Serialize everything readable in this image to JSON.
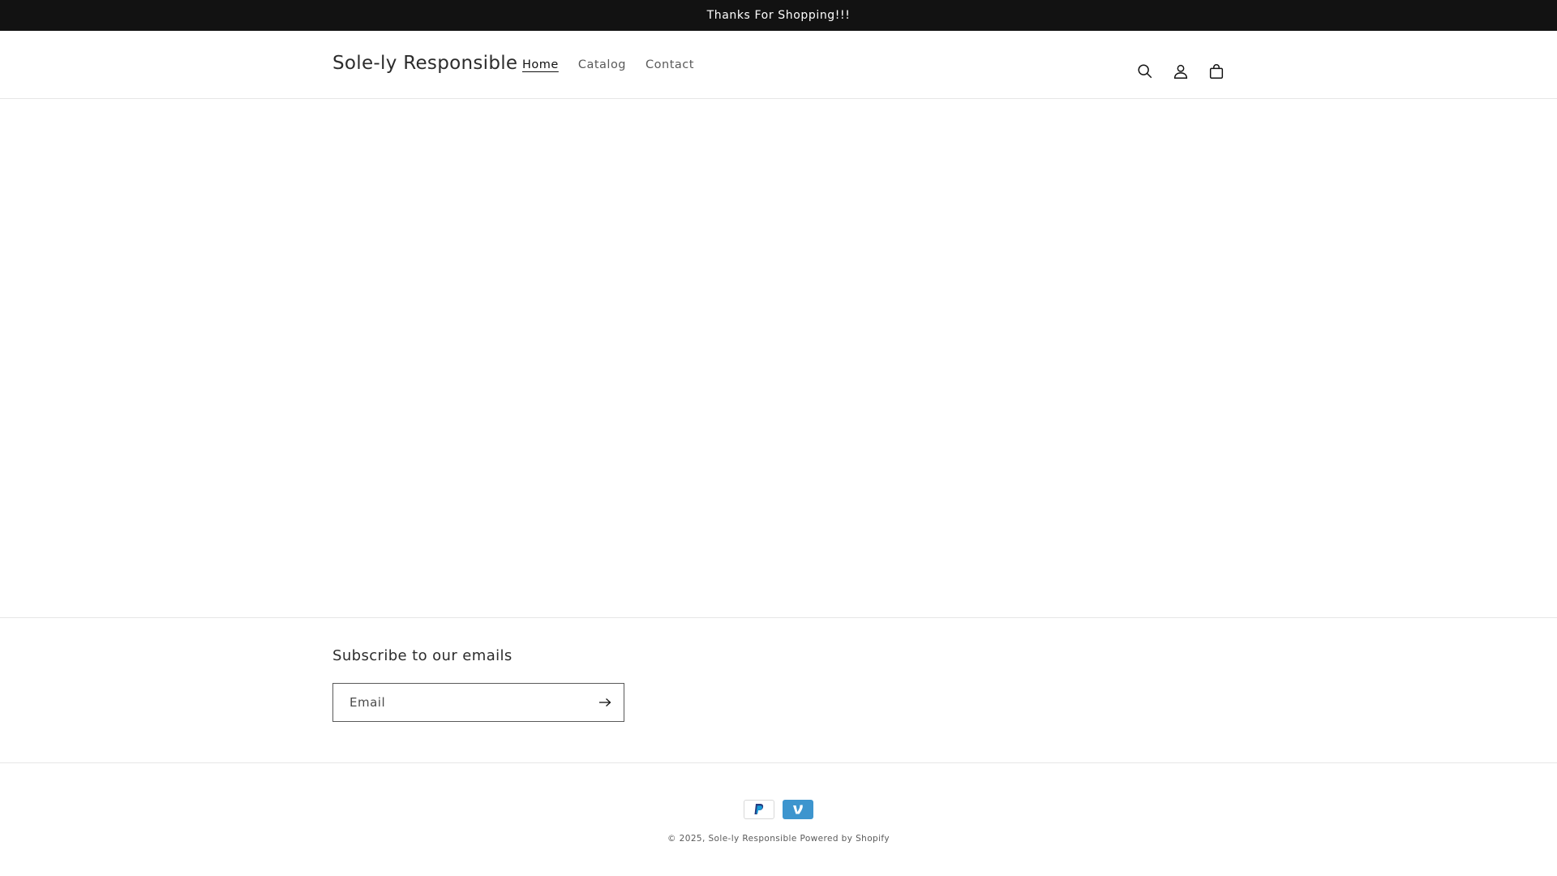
{
  "announcement": {
    "text": "Thanks For Shopping!!!"
  },
  "header": {
    "logo": "Sole-ly Responsible",
    "nav": [
      {
        "label": "Home",
        "active": true
      },
      {
        "label": "Catalog",
        "active": false
      },
      {
        "label": "Contact",
        "active": false
      }
    ],
    "icons": [
      "search-icon",
      "account-icon",
      "cart-icon"
    ]
  },
  "footer": {
    "subscribe_title": "Subscribe to our emails",
    "email_placeholder": "Email",
    "email_value": "",
    "submit_icon": "arrow-right-icon",
    "payment_methods": [
      "PayPal",
      "Venmo"
    ],
    "copyright_prefix": "© 2025,",
    "copyright_store": "Sole-ly Responsible",
    "powered_by": "Powered by Shopify"
  },
  "colors": {
    "announcement_bg": "#121212",
    "text": "#121212",
    "venmo": "#3d95ce",
    "paypal_blue": "#253b80"
  }
}
